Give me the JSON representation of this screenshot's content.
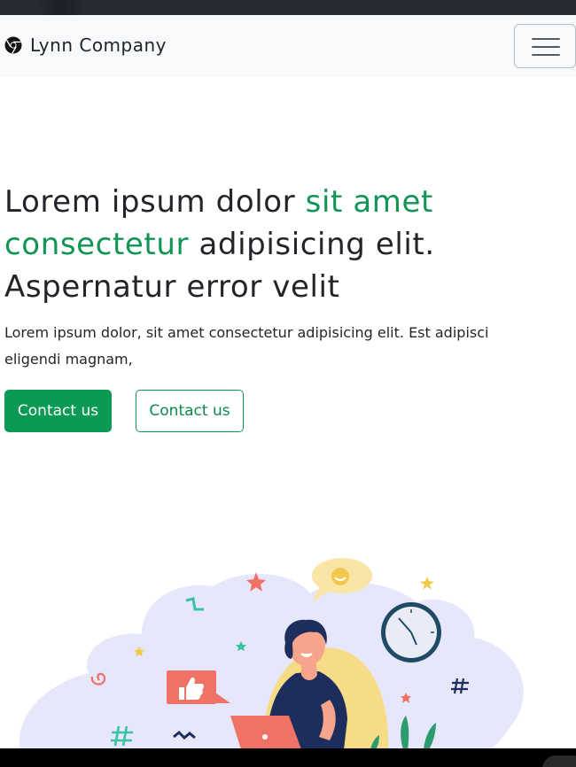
{
  "navbar": {
    "brand_name": "Lynn Company",
    "brand_icon": "chrome-logo-icon",
    "menu_toggle_icon": "hamburger-menu-icon"
  },
  "hero": {
    "title_part1": "Lorem ipsum dolor ",
    "title_accent": "sit amet consectetur",
    "title_part2": " adipisicing elit. Aspernatur error velit",
    "description": "Lorem ipsum dolor, sit amet consectetur adipisicing elit. Est adipisci eligendi magnam,",
    "primary_button": "Contact us",
    "secondary_button": "Contact us"
  },
  "illustration": {
    "name": "person-with-laptop-illustration"
  },
  "colors": {
    "accent": "#109555",
    "button_primary_bg": "#0a9a55",
    "navbar_bg": "#f8f9fa",
    "top_strip": "#262a33",
    "blob": "#e6e7fb"
  }
}
